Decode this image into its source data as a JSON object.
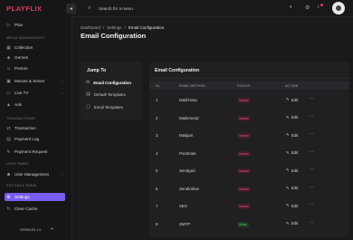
{
  "app": {
    "logo": "PLAYFLIX",
    "version": "VERSION 1.0"
  },
  "sidebar": {
    "items": [
      {
        "label": "Plan",
        "icon": "play-icon"
      },
      {
        "section": "MEDIA MANAGEMENT"
      },
      {
        "label": "Collection",
        "icon": "collection-icon"
      },
      {
        "label": "Genres",
        "icon": "genres-icon"
      },
      {
        "label": "Person",
        "icon": "person-icon"
      },
      {
        "label": "Movies & Series",
        "icon": "film-icon",
        "chevron": true
      },
      {
        "label": "Live TV",
        "icon": "tv-icon",
        "chevron": true
      },
      {
        "label": "Ads",
        "icon": "ads-icon"
      },
      {
        "section": "TRANSACTIONS"
      },
      {
        "label": "Transaction",
        "icon": "transaction-icon"
      },
      {
        "label": "Payment Log",
        "icon": "log-icon"
      },
      {
        "label": "Payment Request",
        "icon": "request-icon"
      },
      {
        "section": "USER PANEL"
      },
      {
        "label": "User Management",
        "icon": "users-icon",
        "chevron": true
      },
      {
        "section": "SETTINGS PANEL"
      },
      {
        "label": "Settings",
        "icon": "gear-icon",
        "active": true
      },
      {
        "label": "Clear Cache",
        "icon": "refresh-icon"
      }
    ]
  },
  "topbar": {
    "search_placeholder": "Search for a menu"
  },
  "breadcrumb": [
    "Dashboard",
    "Settings",
    "Email Configuration"
  ],
  "page_title": "Email Configuration",
  "jump": {
    "title": "Jump To",
    "items": [
      {
        "label": "Email Configuration",
        "active": true
      },
      {
        "label": "Default Templates"
      },
      {
        "label": "Email Templates"
      }
    ]
  },
  "table": {
    "title": "Email Configuration",
    "headers": [
      "SL",
      "EMAIL METHOD",
      "STATUS",
      "ACTION"
    ],
    "edit_label": "Edit",
    "rows": [
      {
        "sl": "1",
        "method": "Mailchimp",
        "status": "Inactive",
        "active": false
      },
      {
        "sl": "2",
        "method": "Mailersend",
        "status": "Inactive",
        "active": false
      },
      {
        "sl": "3",
        "method": "Mailgun",
        "status": "Inactive",
        "active": false
      },
      {
        "sl": "4",
        "method": "Postmark",
        "status": "Inactive",
        "active": false
      },
      {
        "sl": "5",
        "method": "Sendgrid",
        "status": "Inactive",
        "active": false
      },
      {
        "sl": "6",
        "method": "Sendinblue",
        "status": "Inactive",
        "active": false
      },
      {
        "sl": "7",
        "method": "SES",
        "status": "Inactive",
        "active": false
      },
      {
        "sl": "8",
        "method": "SMTP",
        "status": "Active",
        "active": true
      }
    ]
  },
  "colors": {
    "accent": "#7a5cf0",
    "brand": "#e23a5f",
    "inactive": "#f0577e",
    "active": "#4fd46a"
  }
}
